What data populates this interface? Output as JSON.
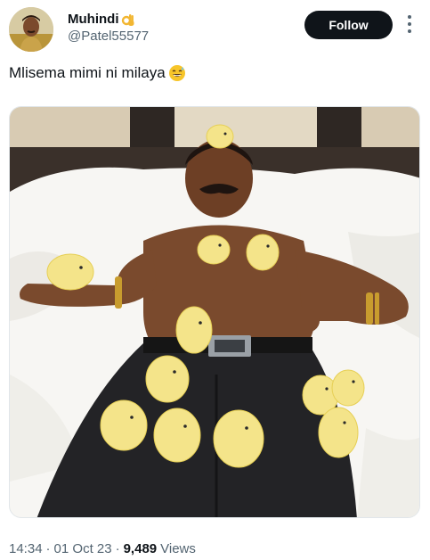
{
  "author": {
    "display_name": "Muhindi",
    "handle": "@Patel55577",
    "badge_emoji": "👌"
  },
  "actions": {
    "follow_label": "Follow",
    "more_icon": "more-vertical-icon"
  },
  "post": {
    "text": "Mlisema mimi ni milaya",
    "emoji": "😅"
  },
  "meta": {
    "time": "14:34",
    "date": "01 Oct 23",
    "views_count": "9,489",
    "views_label": "Views",
    "separator": "·"
  },
  "colors": {
    "text_primary": "#0f1419",
    "text_secondary": "#536471",
    "follow_bg": "#0f1419",
    "emoji_yellow": "#f7c52a"
  }
}
